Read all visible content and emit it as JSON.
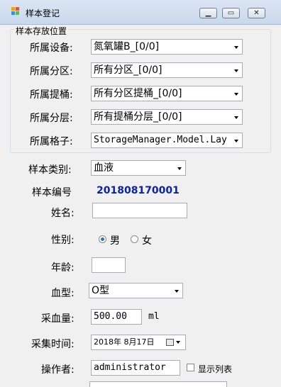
{
  "window": {
    "title": "样本登记"
  },
  "storage_group": {
    "title": "样本存放位置",
    "device_label": "所属设备:",
    "device_value": "氮氧罐B_[0/0]",
    "zone_label": "所属分区:",
    "zone_value": "所有分区_[0/0]",
    "bucket_label": "所属提桶:",
    "bucket_value": "所有分区提桶_[0/0]",
    "layer_label": "所属分层:",
    "layer_value": "所有提桶分层_[0/0]",
    "cell_label": "所属格子:",
    "cell_value": "StorageManager.Model.Lay"
  },
  "sample": {
    "type_label": "样本类别:",
    "type_value": "血液",
    "number_label": "样本编号",
    "number_value": "201808170001",
    "name_label": "姓名:",
    "name_value": "",
    "gender_label": "性别:",
    "gender_male": "男",
    "gender_female": "女",
    "age_label": "年龄:",
    "age_value": "",
    "blood_type_label": "血型:",
    "blood_type_value": "O型",
    "volume_label": "采血量:",
    "volume_value": "500.00",
    "volume_unit": "ml",
    "time_label": "采集时间:",
    "time_value": "2018年 8月17日",
    "operator_label": "操作者:",
    "operator_value": "administrator",
    "show_list_label": "显示列表"
  }
}
